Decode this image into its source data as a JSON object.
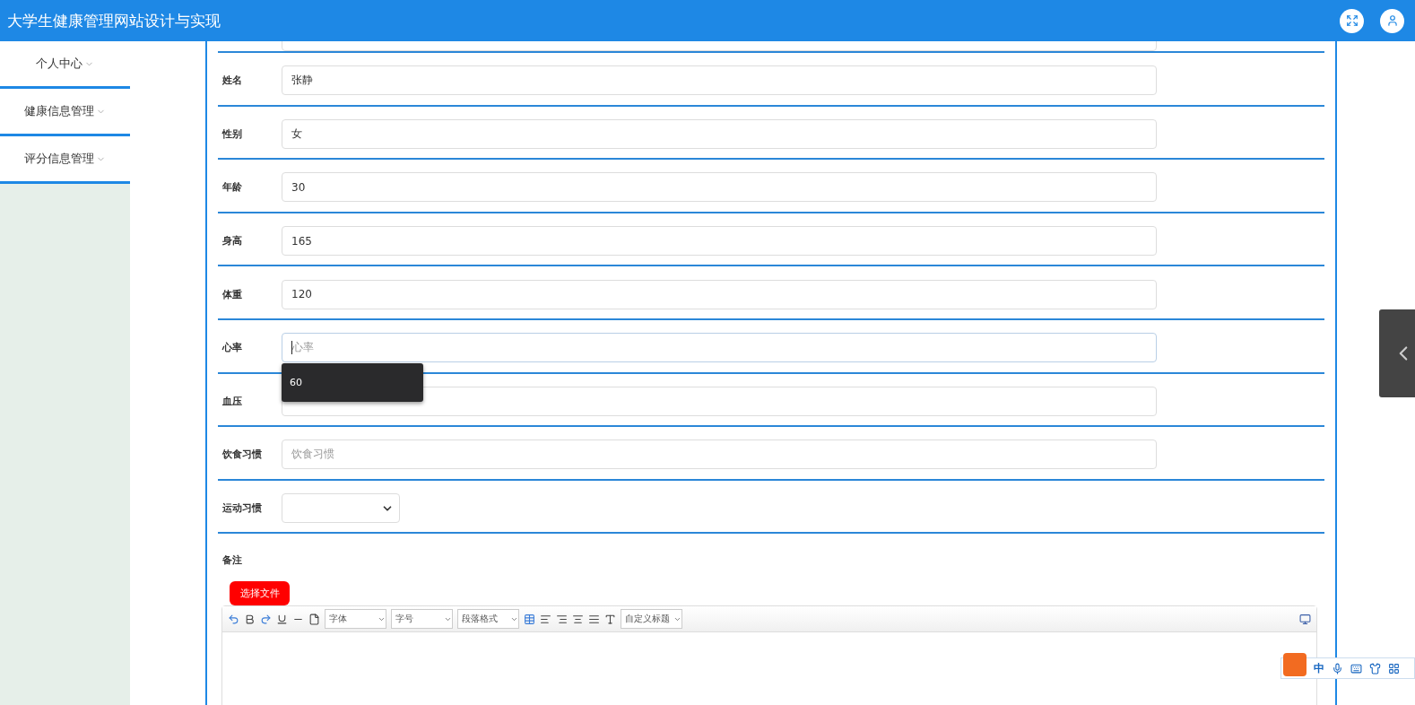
{
  "header": {
    "title": "大学生健康管理网站设计与实现"
  },
  "sidebar": {
    "items": [
      {
        "label": "个人中心"
      },
      {
        "label": "健康信息管理"
      },
      {
        "label": "评分信息管理"
      }
    ]
  },
  "form": {
    "fields": [
      {
        "label": "姓名",
        "kind": "text",
        "value": "张静",
        "focused": false
      },
      {
        "label": "性别",
        "kind": "text",
        "value": "女",
        "focused": false
      },
      {
        "label": "年龄",
        "kind": "text",
        "value": "30",
        "focused": false
      },
      {
        "label": "身高",
        "kind": "text",
        "value": "165",
        "focused": false
      },
      {
        "label": "体重",
        "kind": "text",
        "value": "120",
        "focused": false
      },
      {
        "label": "心率",
        "kind": "text",
        "placeholder": "心率",
        "focused": true
      },
      {
        "label": "血压",
        "kind": "text",
        "focused": false
      },
      {
        "label": "饮食习惯",
        "kind": "text",
        "placeholder": "饮食习惯",
        "focused": false
      },
      {
        "label": "运动习惯",
        "kind": "select"
      }
    ],
    "autocomplete": {
      "options": [
        "60"
      ]
    },
    "remarks": {
      "label": "备注",
      "upload_button": "选择文件",
      "toolbar": [
        {
          "kind": "undo"
        },
        {
          "kind": "bold"
        },
        {
          "kind": "redo"
        },
        {
          "kind": "underline"
        },
        {
          "kind": "rule"
        },
        {
          "kind": "page"
        },
        {
          "kind": "select",
          "label": "字体"
        },
        {
          "kind": "select",
          "label": "字号"
        },
        {
          "kind": "select",
          "label": "段落格式"
        },
        {
          "kind": "table"
        },
        {
          "kind": "left"
        },
        {
          "kind": "right"
        },
        {
          "kind": "center"
        },
        {
          "kind": "justify"
        },
        {
          "kind": "color"
        },
        {
          "kind": "select",
          "label": "自定义标题"
        }
      ]
    }
  },
  "ime_bar": {
    "label": "中"
  }
}
